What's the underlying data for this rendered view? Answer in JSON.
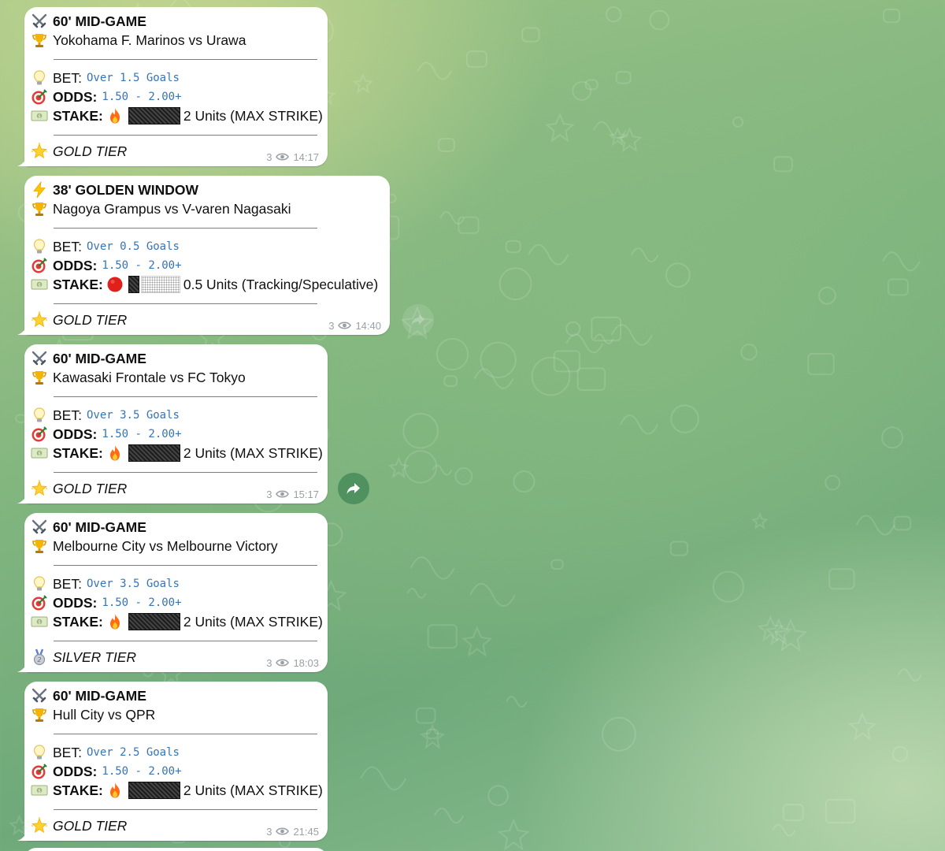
{
  "messages": [
    {
      "phase": "60' MID-GAME",
      "phase_icon": "crossed-swords-icon",
      "match": "Yokohama F. Marinos vs Urawa",
      "bet_label": "BET:",
      "bet_value": "Over 1.5 Goals",
      "odds_label": "ODDS:",
      "odds_value": "1.50 - 2.00+",
      "stake_label": "STAKE:",
      "stake_icon": "fire-icon",
      "stake_value": "2 Units (MAX STRIKE)",
      "tier": "GOLD TIER",
      "tier_icon": "glowing-star-icon",
      "views": "3",
      "time": "14:17"
    },
    {
      "phase": "38' GOLDEN WINDOW",
      "phase_icon": "lightning-icon",
      "match": "Nagoya Grampus vs V-varen Nagasaki",
      "bet_label": "BET:",
      "bet_value": "Over 0.5 Goals",
      "odds_label": "ODDS:",
      "odds_value": "1.50 - 2.00+",
      "stake_label": "STAKE:",
      "stake_icon": "red-circle-icon",
      "stake_value": "0.5 Units (Tracking/Speculative)",
      "tier": "GOLD TIER",
      "tier_icon": "glowing-star-icon",
      "views": "3",
      "time": "14:40"
    },
    {
      "phase": "60' MID-GAME",
      "phase_icon": "crossed-swords-icon",
      "match": "Kawasaki Frontale vs FC Tokyo",
      "bet_label": "BET:",
      "bet_value": "Over 3.5 Goals",
      "odds_label": "ODDS:",
      "odds_value": "1.50 - 2.00+",
      "stake_label": "STAKE:",
      "stake_icon": "fire-icon",
      "stake_value": "2 Units (MAX STRIKE)",
      "tier": "GOLD TIER",
      "tier_icon": "glowing-star-icon",
      "views": "3",
      "time": "15:17"
    },
    {
      "phase": "60' MID-GAME",
      "phase_icon": "crossed-swords-icon",
      "match": "Melbourne City vs Melbourne Victory",
      "bet_label": "BET:",
      "bet_value": "Over 3.5 Goals",
      "odds_label": "ODDS:",
      "odds_value": "1.50 - 2.00+",
      "stake_label": "STAKE:",
      "stake_icon": "fire-icon",
      "stake_value": "2 Units (MAX STRIKE)",
      "tier": "SILVER TIER",
      "tier_icon": "silver-medal-icon",
      "views": "3",
      "time": "18:03"
    },
    {
      "phase": "60' MID-GAME",
      "phase_icon": "crossed-swords-icon",
      "match": "Hull City vs QPR",
      "bet_label": "BET:",
      "bet_value": "Over 2.5 Goals",
      "odds_label": "ODDS:",
      "odds_value": "1.50 - 2.00+",
      "stake_label": "STAKE:",
      "stake_icon": "fire-icon",
      "stake_value": "2 Units (MAX STRIKE)",
      "tier": "GOLD TIER",
      "tier_icon": "glowing-star-icon",
      "views": "3",
      "time": "21:45"
    }
  ],
  "colors": {
    "code_text": "#3574b5",
    "meta_text": "#9aa0a6",
    "forward_button": "#468c5a"
  }
}
